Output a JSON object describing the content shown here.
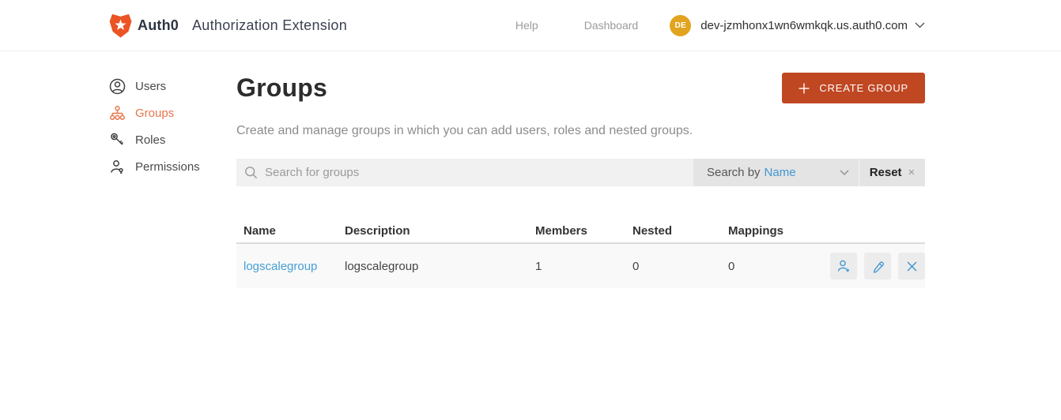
{
  "header": {
    "brand": "Auth0",
    "app_title": "Authorization Extension",
    "nav": {
      "help": "Help",
      "dashboard": "Dashboard"
    },
    "user": {
      "initials": "DE",
      "tenant": "dev-jzmhonx1wn6wmkqk.us.auth0.com"
    }
  },
  "sidebar": {
    "items": {
      "users": "Users",
      "groups": "Groups",
      "roles": "Roles",
      "permissions": "Permissions"
    },
    "active_item": "Groups"
  },
  "main": {
    "title": "Groups",
    "create_button_label": "CREATE GROUP",
    "description": "Create and manage groups in which you can add users, roles and nested groups.",
    "search": {
      "placeholder": "Search for groups",
      "search_by_label": "Search by",
      "search_by_value": "Name",
      "reset_label": "Reset",
      "reset_icon": "×"
    },
    "table": {
      "columns": [
        "Name",
        "Description",
        "Members",
        "Nested",
        "Mappings"
      ],
      "rows": [
        {
          "name": "logscalegroup",
          "description": "logscalegroup",
          "members": "1",
          "nested": "0",
          "mappings": "0"
        }
      ]
    }
  },
  "colors": {
    "button_orange": "#bf4722",
    "active_nav_orange": "#e8764c",
    "link_blue": "#459ed6",
    "avatar_amber": "#e2a41f"
  }
}
